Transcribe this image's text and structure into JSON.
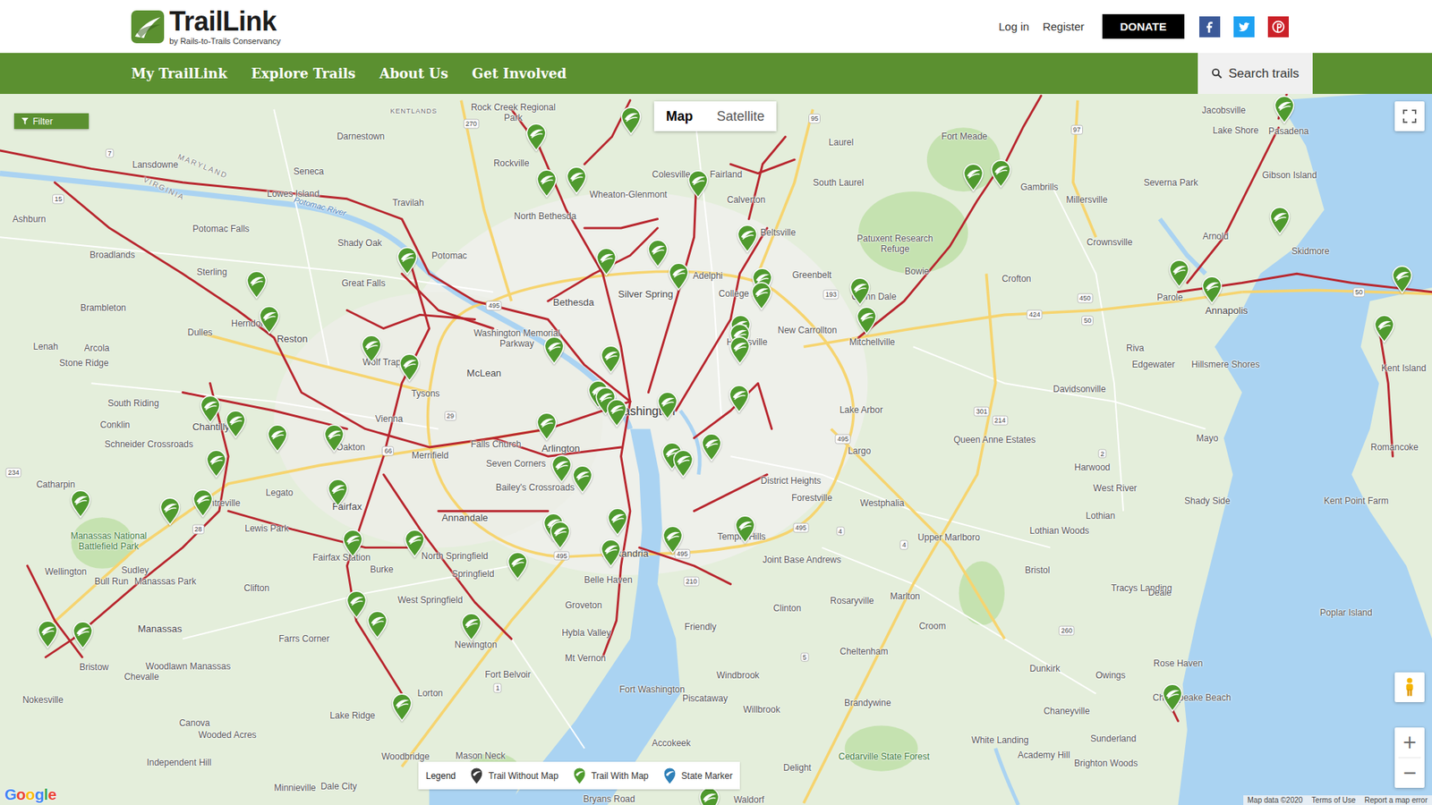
{
  "header": {
    "logo": {
      "title": "TrailLink",
      "subtitle": "by Rails-to-Trails Conservancy"
    },
    "links": [
      "Log in",
      "Register"
    ],
    "donate": "DONATE",
    "social": [
      {
        "kind": "facebook",
        "color": "#3b5998"
      },
      {
        "kind": "twitter",
        "color": "#1da1f2"
      },
      {
        "kind": "pinterest",
        "color": "#cb2027"
      }
    ]
  },
  "nav": {
    "items": [
      "My TrailLink",
      "Explore Trails",
      "About Us",
      "Get Involved"
    ],
    "search": "Search trails"
  },
  "map": {
    "filter": "Filter",
    "map_types": [
      {
        "label": "Map",
        "selected": true
      },
      {
        "label": "Satellite",
        "selected": false
      }
    ],
    "labels": [
      {
        "text": "KENTLANDS",
        "kind": "small"
      },
      {
        "text": "Rock Creek Regional Park",
        "kind": "town"
      },
      {
        "text": "Darnestown",
        "kind": "town"
      },
      {
        "text": "Rockville",
        "kind": "town"
      },
      {
        "text": "Lansdowne",
        "kind": "town"
      },
      {
        "text": "Seneca",
        "kind": "town"
      },
      {
        "text": "Lowes Island",
        "kind": "town"
      },
      {
        "text": "Travilah",
        "kind": "town"
      },
      {
        "text": "MARYLAND",
        "kind": "state"
      },
      {
        "text": "VIRGINIA",
        "kind": "state"
      },
      {
        "text": "Potomac River",
        "kind": "water"
      },
      {
        "text": "Ashburn",
        "kind": "town"
      },
      {
        "text": "Potomac Falls",
        "kind": "town"
      },
      {
        "text": "Shady Oak",
        "kind": "town"
      },
      {
        "text": "Potomac",
        "kind": "town"
      },
      {
        "text": "North Bethesda",
        "kind": "town"
      },
      {
        "text": "Wheaton-Glenmont",
        "kind": "town"
      },
      {
        "text": "Colesville",
        "kind": "town"
      },
      {
        "text": "Fairland",
        "kind": "town"
      },
      {
        "text": "Calverton",
        "kind": "town"
      },
      {
        "text": "Beltsville",
        "kind": "town"
      },
      {
        "text": "Laurel",
        "kind": "town"
      },
      {
        "text": "South Laurel",
        "kind": "town"
      },
      {
        "text": "Fort Meade",
        "kind": "town"
      },
      {
        "text": "Gambrills",
        "kind": "town"
      },
      {
        "text": "Millersville",
        "kind": "town"
      },
      {
        "text": "Jacobsville",
        "kind": "town"
      },
      {
        "text": "Lake Shore",
        "kind": "town"
      },
      {
        "text": "Pasadena",
        "kind": "town"
      },
      {
        "text": "Gibson Island",
        "kind": "town"
      },
      {
        "text": "Severna Park",
        "kind": "town"
      },
      {
        "text": "Crownsville",
        "kind": "town"
      },
      {
        "text": "Arnold",
        "kind": "town"
      },
      {
        "text": "Skidmore",
        "kind": "town"
      },
      {
        "text": "Patuxent Research Refuge",
        "kind": "town"
      },
      {
        "text": "Bowie",
        "kind": "town"
      },
      {
        "text": "Crofton",
        "kind": "town"
      },
      {
        "text": "Parole",
        "kind": "town"
      },
      {
        "text": "Annapolis",
        "kind": "city"
      },
      {
        "text": "Broadlands",
        "kind": "town"
      },
      {
        "text": "Sterling",
        "kind": "town"
      },
      {
        "text": "Great Falls",
        "kind": "town"
      },
      {
        "text": "Bethesda",
        "kind": "city"
      },
      {
        "text": "Silver Spring",
        "kind": "city"
      },
      {
        "text": "Adelphi",
        "kind": "town"
      },
      {
        "text": "College Park",
        "kind": "town"
      },
      {
        "text": "Greenbelt",
        "kind": "town"
      },
      {
        "text": "Glenn Dale",
        "kind": "town"
      },
      {
        "text": "New Carrollton",
        "kind": "town"
      },
      {
        "text": "Brambleton",
        "kind": "town"
      },
      {
        "text": "Dulles",
        "kind": "town"
      },
      {
        "text": "Herndon",
        "kind": "town"
      },
      {
        "text": "Reston",
        "kind": "city"
      },
      {
        "text": "Lenah",
        "kind": "town"
      },
      {
        "text": "Arcola",
        "kind": "town"
      },
      {
        "text": "Stone Ridge",
        "kind": "town"
      },
      {
        "text": "McLean",
        "kind": "city"
      },
      {
        "text": "Washington Memorial Parkway",
        "kind": "town"
      },
      {
        "text": "Wolf Trap",
        "kind": "town"
      },
      {
        "text": "Tysons",
        "kind": "town"
      },
      {
        "text": "Hyattsville",
        "kind": "town"
      },
      {
        "text": "Mitchellville",
        "kind": "town"
      },
      {
        "text": "Riva",
        "kind": "town"
      },
      {
        "text": "Edgewater",
        "kind": "town"
      },
      {
        "text": "Hillsmere Shores",
        "kind": "town"
      },
      {
        "text": "Kent Island",
        "kind": "town"
      },
      {
        "text": "Davidsonville",
        "kind": "town"
      },
      {
        "text": "South Riding",
        "kind": "town"
      },
      {
        "text": "Chantilly",
        "kind": "city"
      },
      {
        "text": "Conklin",
        "kind": "town"
      },
      {
        "text": "Schneider Crossroads",
        "kind": "town"
      },
      {
        "text": "Vienna",
        "kind": "town"
      },
      {
        "text": "Oakton",
        "kind": "town"
      },
      {
        "text": "Merrifield",
        "kind": "town"
      },
      {
        "text": "Falls Church",
        "kind": "town"
      },
      {
        "text": "Arlington",
        "kind": "city"
      },
      {
        "text": "Washington",
        "kind": "big"
      },
      {
        "text": "Lake Arbor",
        "kind": "town"
      },
      {
        "text": "Queen Anne Estates",
        "kind": "town"
      },
      {
        "text": "Largo",
        "kind": "town"
      },
      {
        "text": "Mayo",
        "kind": "town"
      },
      {
        "text": "Romancoke",
        "kind": "town"
      },
      {
        "text": "Harwood",
        "kind": "town"
      },
      {
        "text": "Seven Corners",
        "kind": "town"
      },
      {
        "text": "Bailey's Crossroads",
        "kind": "town"
      },
      {
        "text": "District Heights",
        "kind": "town"
      },
      {
        "text": "Forestville",
        "kind": "town"
      },
      {
        "text": "Westphalia",
        "kind": "town"
      },
      {
        "text": "West River",
        "kind": "town"
      },
      {
        "text": "Shady Side",
        "kind": "town"
      },
      {
        "text": "Kent Point Farm",
        "kind": "town"
      },
      {
        "text": "Catharpin",
        "kind": "town"
      },
      {
        "text": "Centreville",
        "kind": "town"
      },
      {
        "text": "Legato",
        "kind": "town"
      },
      {
        "text": "Fairfax",
        "kind": "city"
      },
      {
        "text": "Annandale",
        "kind": "city"
      },
      {
        "text": "Lothian",
        "kind": "town"
      },
      {
        "text": "Lothian Woods",
        "kind": "town"
      },
      {
        "text": "Upper Marlboro",
        "kind": "town"
      },
      {
        "text": "Manassas National Battlefield Park",
        "kind": "park"
      },
      {
        "text": "Lewis Park",
        "kind": "town"
      },
      {
        "text": "Fairfax Station",
        "kind": "town"
      },
      {
        "text": "North Springfield",
        "kind": "town"
      },
      {
        "text": "Springfield",
        "kind": "town"
      },
      {
        "text": "Alexandria",
        "kind": "city"
      },
      {
        "text": "Temple Hills",
        "kind": "town"
      },
      {
        "text": "Joint Base Andrews",
        "kind": "town"
      },
      {
        "text": "Bristol",
        "kind": "town"
      },
      {
        "text": "Tracys Landing",
        "kind": "town"
      },
      {
        "text": "Deale",
        "kind": "town"
      },
      {
        "text": "Poplar Island",
        "kind": "town"
      },
      {
        "text": "Wellington",
        "kind": "town"
      },
      {
        "text": "Sudley",
        "kind": "town"
      },
      {
        "text": "Bull Run",
        "kind": "town"
      },
      {
        "text": "Manassas Park",
        "kind": "town"
      },
      {
        "text": "Clifton",
        "kind": "town"
      },
      {
        "text": "Burke",
        "kind": "town"
      },
      {
        "text": "Belle Haven",
        "kind": "town"
      },
      {
        "text": "Rosaryville",
        "kind": "town"
      },
      {
        "text": "Marlton",
        "kind": "town"
      },
      {
        "text": "West Springfield",
        "kind": "town"
      },
      {
        "text": "Groveton",
        "kind": "town"
      },
      {
        "text": "Clinton",
        "kind": "town"
      },
      {
        "text": "Croom",
        "kind": "town"
      },
      {
        "text": "Friendly",
        "kind": "town"
      },
      {
        "text": "Manassas",
        "kind": "city"
      },
      {
        "text": "Farrs Corner",
        "kind": "town"
      },
      {
        "text": "Hybla Valley",
        "kind": "town"
      },
      {
        "text": "Newington",
        "kind": "town"
      },
      {
        "text": "Cheltenham",
        "kind": "town"
      },
      {
        "text": "Rose Haven",
        "kind": "town"
      },
      {
        "text": "Dunkirk",
        "kind": "town"
      },
      {
        "text": "Owings",
        "kind": "town"
      },
      {
        "text": "Woodlawn Manassas",
        "kind": "town"
      },
      {
        "text": "Bristow",
        "kind": "town"
      },
      {
        "text": "Chevalle",
        "kind": "town"
      },
      {
        "text": "Mt Vernon",
        "kind": "town"
      },
      {
        "text": "Fort Belvoir",
        "kind": "town"
      },
      {
        "text": "Windbrook",
        "kind": "town"
      },
      {
        "text": "Fort Washington",
        "kind": "town"
      },
      {
        "text": "Lorton",
        "kind": "town"
      },
      {
        "text": "Piscataway",
        "kind": "town"
      },
      {
        "text": "Brandywine",
        "kind": "town"
      },
      {
        "text": "Chesapeake Beach",
        "kind": "town"
      },
      {
        "text": "Nokesville",
        "kind": "town"
      },
      {
        "text": "Chaneyville",
        "kind": "town"
      },
      {
        "text": "Willbrook",
        "kind": "town"
      },
      {
        "text": "Lake Ridge",
        "kind": "town"
      },
      {
        "text": "Canova",
        "kind": "town"
      },
      {
        "text": "Wooded Acres",
        "kind": "town"
      },
      {
        "text": "Sunderland",
        "kind": "town"
      },
      {
        "text": "White Landing",
        "kind": "town"
      },
      {
        "text": "Accokeek",
        "kind": "town"
      },
      {
        "text": "Cedarville State Forest",
        "kind": "park"
      },
      {
        "text": "Academy Hill",
        "kind": "town"
      },
      {
        "text": "Mason Neck",
        "kind": "town"
      },
      {
        "text": "Woodbridge",
        "kind": "town"
      },
      {
        "text": "Independent Hill",
        "kind": "town"
      },
      {
        "text": "Brighton Woods",
        "kind": "town"
      },
      {
        "text": "Delight",
        "kind": "town"
      },
      {
        "text": "Dale City",
        "kind": "town"
      },
      {
        "text": "Minnieville",
        "kind": "town"
      },
      {
        "text": "Bryans Road",
        "kind": "town"
      },
      {
        "text": "Waldorf",
        "kind": "town"
      },
      {
        "text": "270",
        "kind": "route"
      },
      {
        "text": "95",
        "kind": "route"
      },
      {
        "text": "97",
        "kind": "route"
      },
      {
        "text": "7",
        "kind": "route"
      },
      {
        "text": "15",
        "kind": "route"
      },
      {
        "text": "495",
        "kind": "route"
      },
      {
        "text": "193",
        "kind": "route"
      },
      {
        "text": "450",
        "kind": "route"
      },
      {
        "text": "424",
        "kind": "route"
      },
      {
        "text": "50",
        "kind": "route"
      },
      {
        "text": "50",
        "kind": "route"
      },
      {
        "text": "29",
        "kind": "route"
      },
      {
        "text": "66",
        "kind": "route"
      },
      {
        "text": "301",
        "kind": "route"
      },
      {
        "text": "214",
        "kind": "route"
      },
      {
        "text": "495",
        "kind": "route"
      },
      {
        "text": "2",
        "kind": "route"
      },
      {
        "text": "234",
        "kind": "route"
      },
      {
        "text": "28",
        "kind": "route"
      },
      {
        "text": "495",
        "kind": "route"
      },
      {
        "text": "4",
        "kind": "route"
      },
      {
        "text": "4",
        "kind": "route"
      },
      {
        "text": "495",
        "kind": "route"
      },
      {
        "text": "495",
        "kind": "route"
      },
      {
        "text": "210",
        "kind": "route"
      },
      {
        "text": "1",
        "kind": "route"
      },
      {
        "text": "5",
        "kind": "route"
      },
      {
        "text": "260",
        "kind": "route"
      }
    ],
    "pins": [
      {
        "kind": "trail-with-map"
      },
      {
        "kind": "trail-with-map"
      },
      {
        "kind": "trail-with-map"
      },
      {
        "kind": "trail-with-map"
      },
      {
        "kind": "trail-with-map"
      },
      {
        "kind": "trail-with-map"
      },
      {
        "kind": "trail-with-map"
      },
      {
        "kind": "trail-with-map"
      },
      {
        "kind": "trail-with-map"
      },
      {
        "kind": "trail-with-map"
      },
      {
        "kind": "trail-with-map"
      },
      {
        "kind": "trail-with-map"
      },
      {
        "kind": "trail-with-map"
      },
      {
        "kind": "trail-with-map"
      },
      {
        "kind": "trail-with-map"
      },
      {
        "kind": "trail-with-map"
      },
      {
        "kind": "trail-with-map"
      },
      {
        "kind": "trail-with-map"
      },
      {
        "kind": "trail-with-map"
      },
      {
        "kind": "trail-with-map"
      },
      {
        "kind": "trail-with-map"
      },
      {
        "kind": "trail-with-map"
      },
      {
        "kind": "trail-with-map"
      },
      {
        "kind": "trail-with-map"
      },
      {
        "kind": "trail-with-map"
      },
      {
        "kind": "trail-with-map"
      },
      {
        "kind": "trail-with-map"
      },
      {
        "kind": "trail-with-map"
      },
      {
        "kind": "trail-with-map"
      },
      {
        "kind": "trail-with-map"
      },
      {
        "kind": "trail-with-map"
      },
      {
        "kind": "trail-with-map"
      },
      {
        "kind": "trail-with-map"
      },
      {
        "kind": "trail-with-map"
      },
      {
        "kind": "trail-with-map"
      },
      {
        "kind": "trail-with-map"
      },
      {
        "kind": "trail-with-map"
      },
      {
        "kind": "trail-with-map"
      },
      {
        "kind": "trail-with-map"
      },
      {
        "kind": "trail-with-map"
      },
      {
        "kind": "trail-with-map"
      },
      {
        "kind": "trail-with-map"
      },
      {
        "kind": "trail-with-map"
      },
      {
        "kind": "trail-with-map"
      },
      {
        "kind": "trail-with-map"
      },
      {
        "kind": "trail-with-map"
      },
      {
        "kind": "trail-with-map"
      },
      {
        "kind": "trail-with-map"
      },
      {
        "kind": "trail-with-map"
      },
      {
        "kind": "trail-with-map"
      },
      {
        "kind": "trail-with-map"
      },
      {
        "kind": "trail-with-map"
      },
      {
        "kind": "trail-with-map"
      },
      {
        "kind": "trail-with-map"
      },
      {
        "kind": "trail-with-map"
      },
      {
        "kind": "trail-with-map"
      },
      {
        "kind": "trail-with-map"
      },
      {
        "kind": "trail-with-map"
      },
      {
        "kind": "trail-with-map"
      },
      {
        "kind": "trail-with-map"
      },
      {
        "kind": "trail-with-map"
      },
      {
        "kind": "trail-with-map"
      },
      {
        "kind": "trail-with-map"
      },
      {
        "kind": "trail-with-map"
      },
      {
        "kind": "trail-with-map"
      },
      {
        "kind": "trail-with-map"
      },
      {
        "kind": "trail-with-map"
      },
      {
        "kind": "trail-with-map"
      }
    ],
    "legend": {
      "title": "Legend",
      "items": [
        {
          "label": "Trail Without Map",
          "kind": "trail-without-map"
        },
        {
          "label": "Trail With Map",
          "kind": "trail-with-map"
        },
        {
          "label": "State Marker",
          "kind": "state-marker"
        }
      ]
    },
    "zoom": {
      "in": "+",
      "out": "−"
    },
    "attribution": {
      "logo": "Google",
      "links": [
        "Map data ©2020",
        "Terms of Use",
        "Report a map error"
      ]
    }
  }
}
